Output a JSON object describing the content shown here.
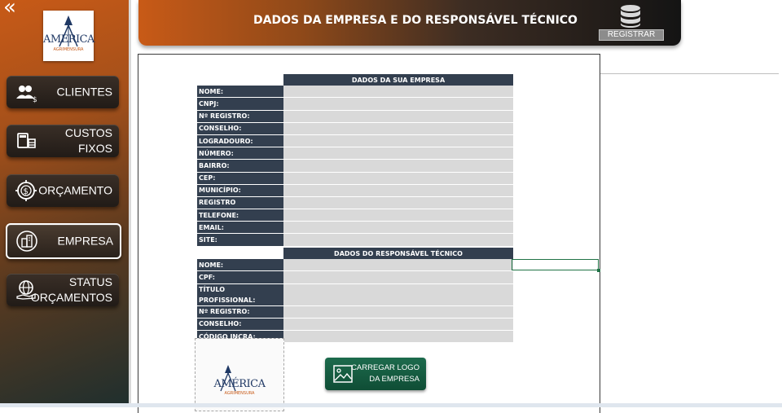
{
  "sidebar": {
    "logo": {
      "brand": "AMÉRICA",
      "tagline": "AGRIMENSURA"
    },
    "items": [
      {
        "label": "CLIENTES",
        "icon": "users-money-icon"
      },
      {
        "label": "CUSTOS\nFIXOS",
        "icon": "calculator-money-icon"
      },
      {
        "label": "ORÇAMENTO",
        "icon": "target-dollar-icon"
      },
      {
        "label": "EMPRESA",
        "icon": "building-icon",
        "active": true
      },
      {
        "label": "STATUS\nORÇAMENTOS",
        "icon": "globe-hand-icon"
      }
    ]
  },
  "header": {
    "title": "DADOS DA EMPRESA E DO RESPONSÁVEL TÉCNICO",
    "register_label": "REGISTRAR"
  },
  "company_section": {
    "title": "DADOS DA SUA EMPRESA",
    "fields": [
      "NOME:",
      "CNPJ:",
      "Nº REGISTRO:",
      "CONSELHO:",
      "LOGRADOURO:",
      "NÚMERO:",
      "BAIRRO:",
      "CEP:",
      "MUNICÍPIO:",
      "REGISTRO",
      "TELEFONE:",
      "EMAIL:",
      "SITE:"
    ]
  },
  "technical_section": {
    "title": "DADOS DO RESPONSÁVEL TÉCNICO",
    "fields": [
      "NOME:",
      "CPF:",
      "TÍTULO PROFISSIONAL:",
      "Nº REGISTRO:",
      "CONSELHO:",
      "CÓDIGO INCRA:"
    ]
  },
  "logo_preview": {
    "brand": "AMÉRICA",
    "tagline": "AGRIMENSURA"
  },
  "upload_button": {
    "label": "CARREGAR LOGO\nDA EMPRESA"
  },
  "colors": {
    "accent_orange": "#c85a17",
    "table_header": "#333f4f",
    "cell_fill": "#d9d9d9",
    "upload_green": "#0f4d35"
  }
}
